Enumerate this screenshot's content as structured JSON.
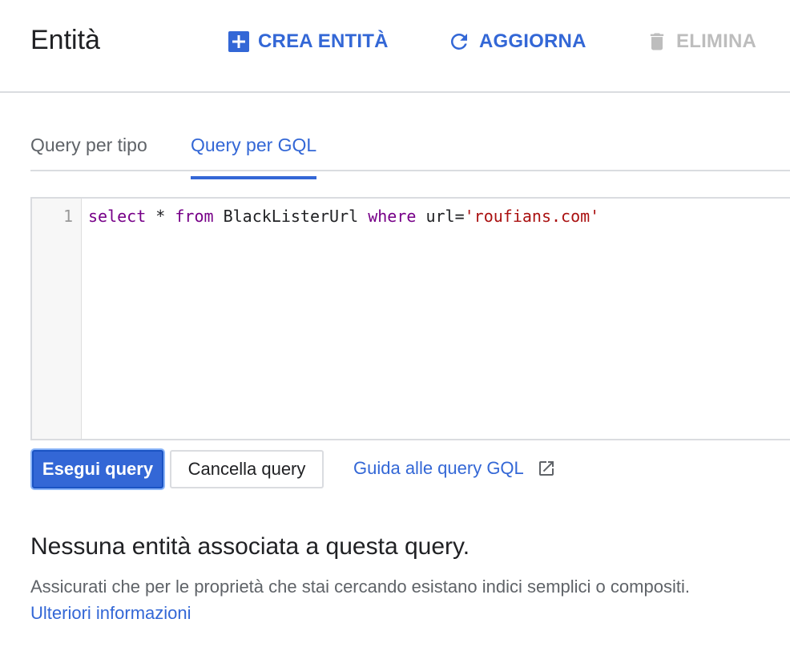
{
  "header": {
    "title": "Entità",
    "create_label": "CREA ENTITÀ",
    "refresh_label": "AGGIORNA",
    "delete_label": "ELIMINA"
  },
  "tabs": [
    {
      "label": "Query per tipo",
      "active": false
    },
    {
      "label": "Query per GQL",
      "active": true
    }
  ],
  "editor": {
    "line_number": "1",
    "tokens": {
      "kw_select": "select",
      "star": " * ",
      "kw_from": "from",
      "kind": " BlackListerUrl ",
      "kw_where": "where",
      "cond": " url=",
      "string": "'roufians.com'"
    }
  },
  "actions": {
    "run_label": "Esegui query",
    "clear_label": "Cancella query",
    "guide_label": "Guida alle query GQL"
  },
  "result": {
    "empty_title": "Nessuna entità associata a questa query.",
    "empty_desc": "Assicurati che per le proprietà che stai cercando esistano indici semplici o compositi.",
    "more_link": "Ulteriori informazioni"
  },
  "colors": {
    "accent": "#3367d6",
    "disabled": "#bdbdbd",
    "keyword": "#770088",
    "string": "#aa1111"
  }
}
